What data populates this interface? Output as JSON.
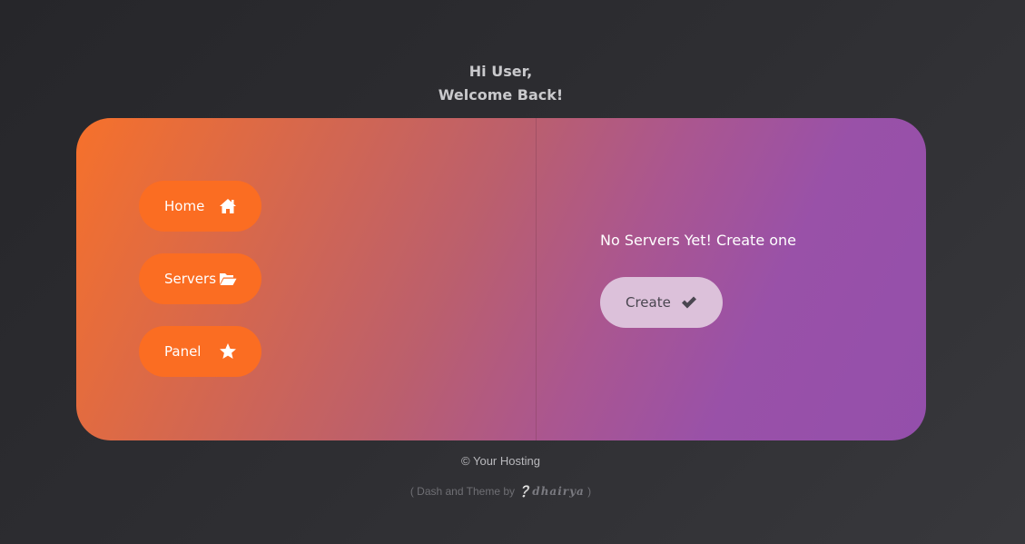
{
  "header": {
    "greeting_line1": "Hi User,",
    "greeting_line2": "Welcome Back!"
  },
  "sidebar": {
    "items": [
      {
        "label": "Home",
        "icon": "home-icon"
      },
      {
        "label": "Servers",
        "icon": "folder-open-icon"
      },
      {
        "label": "Panel",
        "icon": "star-icon"
      }
    ]
  },
  "main": {
    "empty_message": "No Servers Yet! Create one",
    "create_label": "Create",
    "create_icon": "check-icon"
  },
  "footer": {
    "copyright": "© Your Hosting",
    "credit_prefix": "( Dash and Theme by",
    "credit_author": "dhairya",
    "credit_suffix": ")"
  },
  "colors": {
    "background": "#2e2e32",
    "nav_button": "#fb6d22",
    "gradient_start": "#f6712b",
    "gradient_end": "#944fab",
    "create_button": "#dcc1da"
  }
}
